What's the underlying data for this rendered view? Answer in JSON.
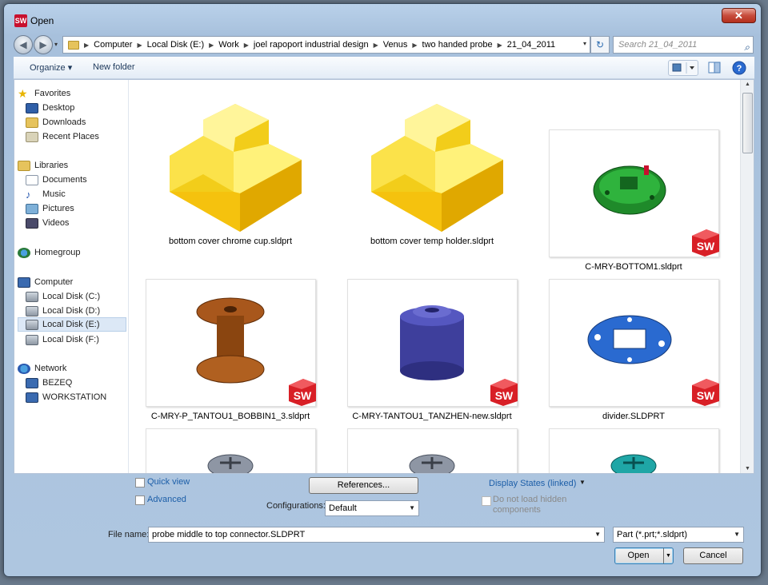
{
  "window": {
    "title": "Open",
    "close_glyph": "✕",
    "app_icon": "solidworks-icon"
  },
  "nav": {
    "back_glyph": "◀",
    "forward_glyph": "▶",
    "dropdown_glyph": "▾",
    "breadcrumb": [
      "Computer",
      "Local Disk (E:)",
      "Work",
      "joel rapoport industrial design",
      "Venus",
      "two handed probe",
      "21_04_2011"
    ],
    "search_placeholder": "Search 21_04_2011",
    "refresh_glyph": "↻",
    "search_glyph": "⌕"
  },
  "toolbar": {
    "organize_label": "Organize ▾",
    "new_folder_label": "New folder",
    "help_glyph": "?"
  },
  "sidebar": {
    "favorites": {
      "label": "Favorites",
      "items": [
        "Desktop",
        "Downloads",
        "Recent Places"
      ]
    },
    "libraries": {
      "label": "Libraries",
      "items": [
        "Documents",
        "Music",
        "Pictures",
        "Videos"
      ]
    },
    "homegroup": {
      "label": "Homegroup"
    },
    "computer": {
      "label": "Computer",
      "items": [
        "Local Disk (C:)",
        "Local Disk (D:)",
        "Local Disk (E:)",
        "Local Disk (F:)"
      ],
      "selected": "Local Disk (E:)"
    },
    "network": {
      "label": "Network",
      "items": [
        "BEZEQ",
        "WORKSTATION"
      ]
    }
  },
  "files": [
    {
      "name": "bottom cover chrome cup.sldprt",
      "thumb": "yellow-part-icon"
    },
    {
      "name": "bottom cover temp holder.sldprt",
      "thumb": "yellow-part-icon"
    },
    {
      "name": "C-MRY-BOTTOM1.sldprt",
      "thumb": "green-pcb-preview"
    },
    {
      "name": "C-MRY-P_TANTOU1_BOBBIN1_3.sldprt",
      "thumb": "brown-bobbin-preview"
    },
    {
      "name": "C-MRY-TANTOU1_TANZHEN-new.sldprt",
      "thumb": "blue-cylinder-preview"
    },
    {
      "name": "divider.SLDPRT",
      "thumb": "blue-divider-preview"
    },
    {
      "name": "",
      "thumb": "grey-screw-preview"
    },
    {
      "name": "",
      "thumb": "grey-screw-preview"
    },
    {
      "name": "",
      "thumb": "teal-screw-preview"
    }
  ],
  "sw_badge_text": "SW",
  "options": {
    "quick_view_label": "Quick view",
    "advanced_label": "Advanced",
    "references_label": "References...",
    "configurations_label": "Configurations:",
    "configuration_value": "Default",
    "display_states_label": "Display States (linked)",
    "do_not_load_label": "Do not load hidden components",
    "file_name_label": "File name:",
    "file_name_value": "probe middle to top connector.SLDPRT",
    "file_type_value": "Part (*.prt;*.sldprt)",
    "open_label": "Open",
    "cancel_label": "Cancel"
  },
  "colors": {
    "accent": "#1c5ea8",
    "folder_yellow": "#f5d421",
    "sw_red": "#d81f26"
  }
}
